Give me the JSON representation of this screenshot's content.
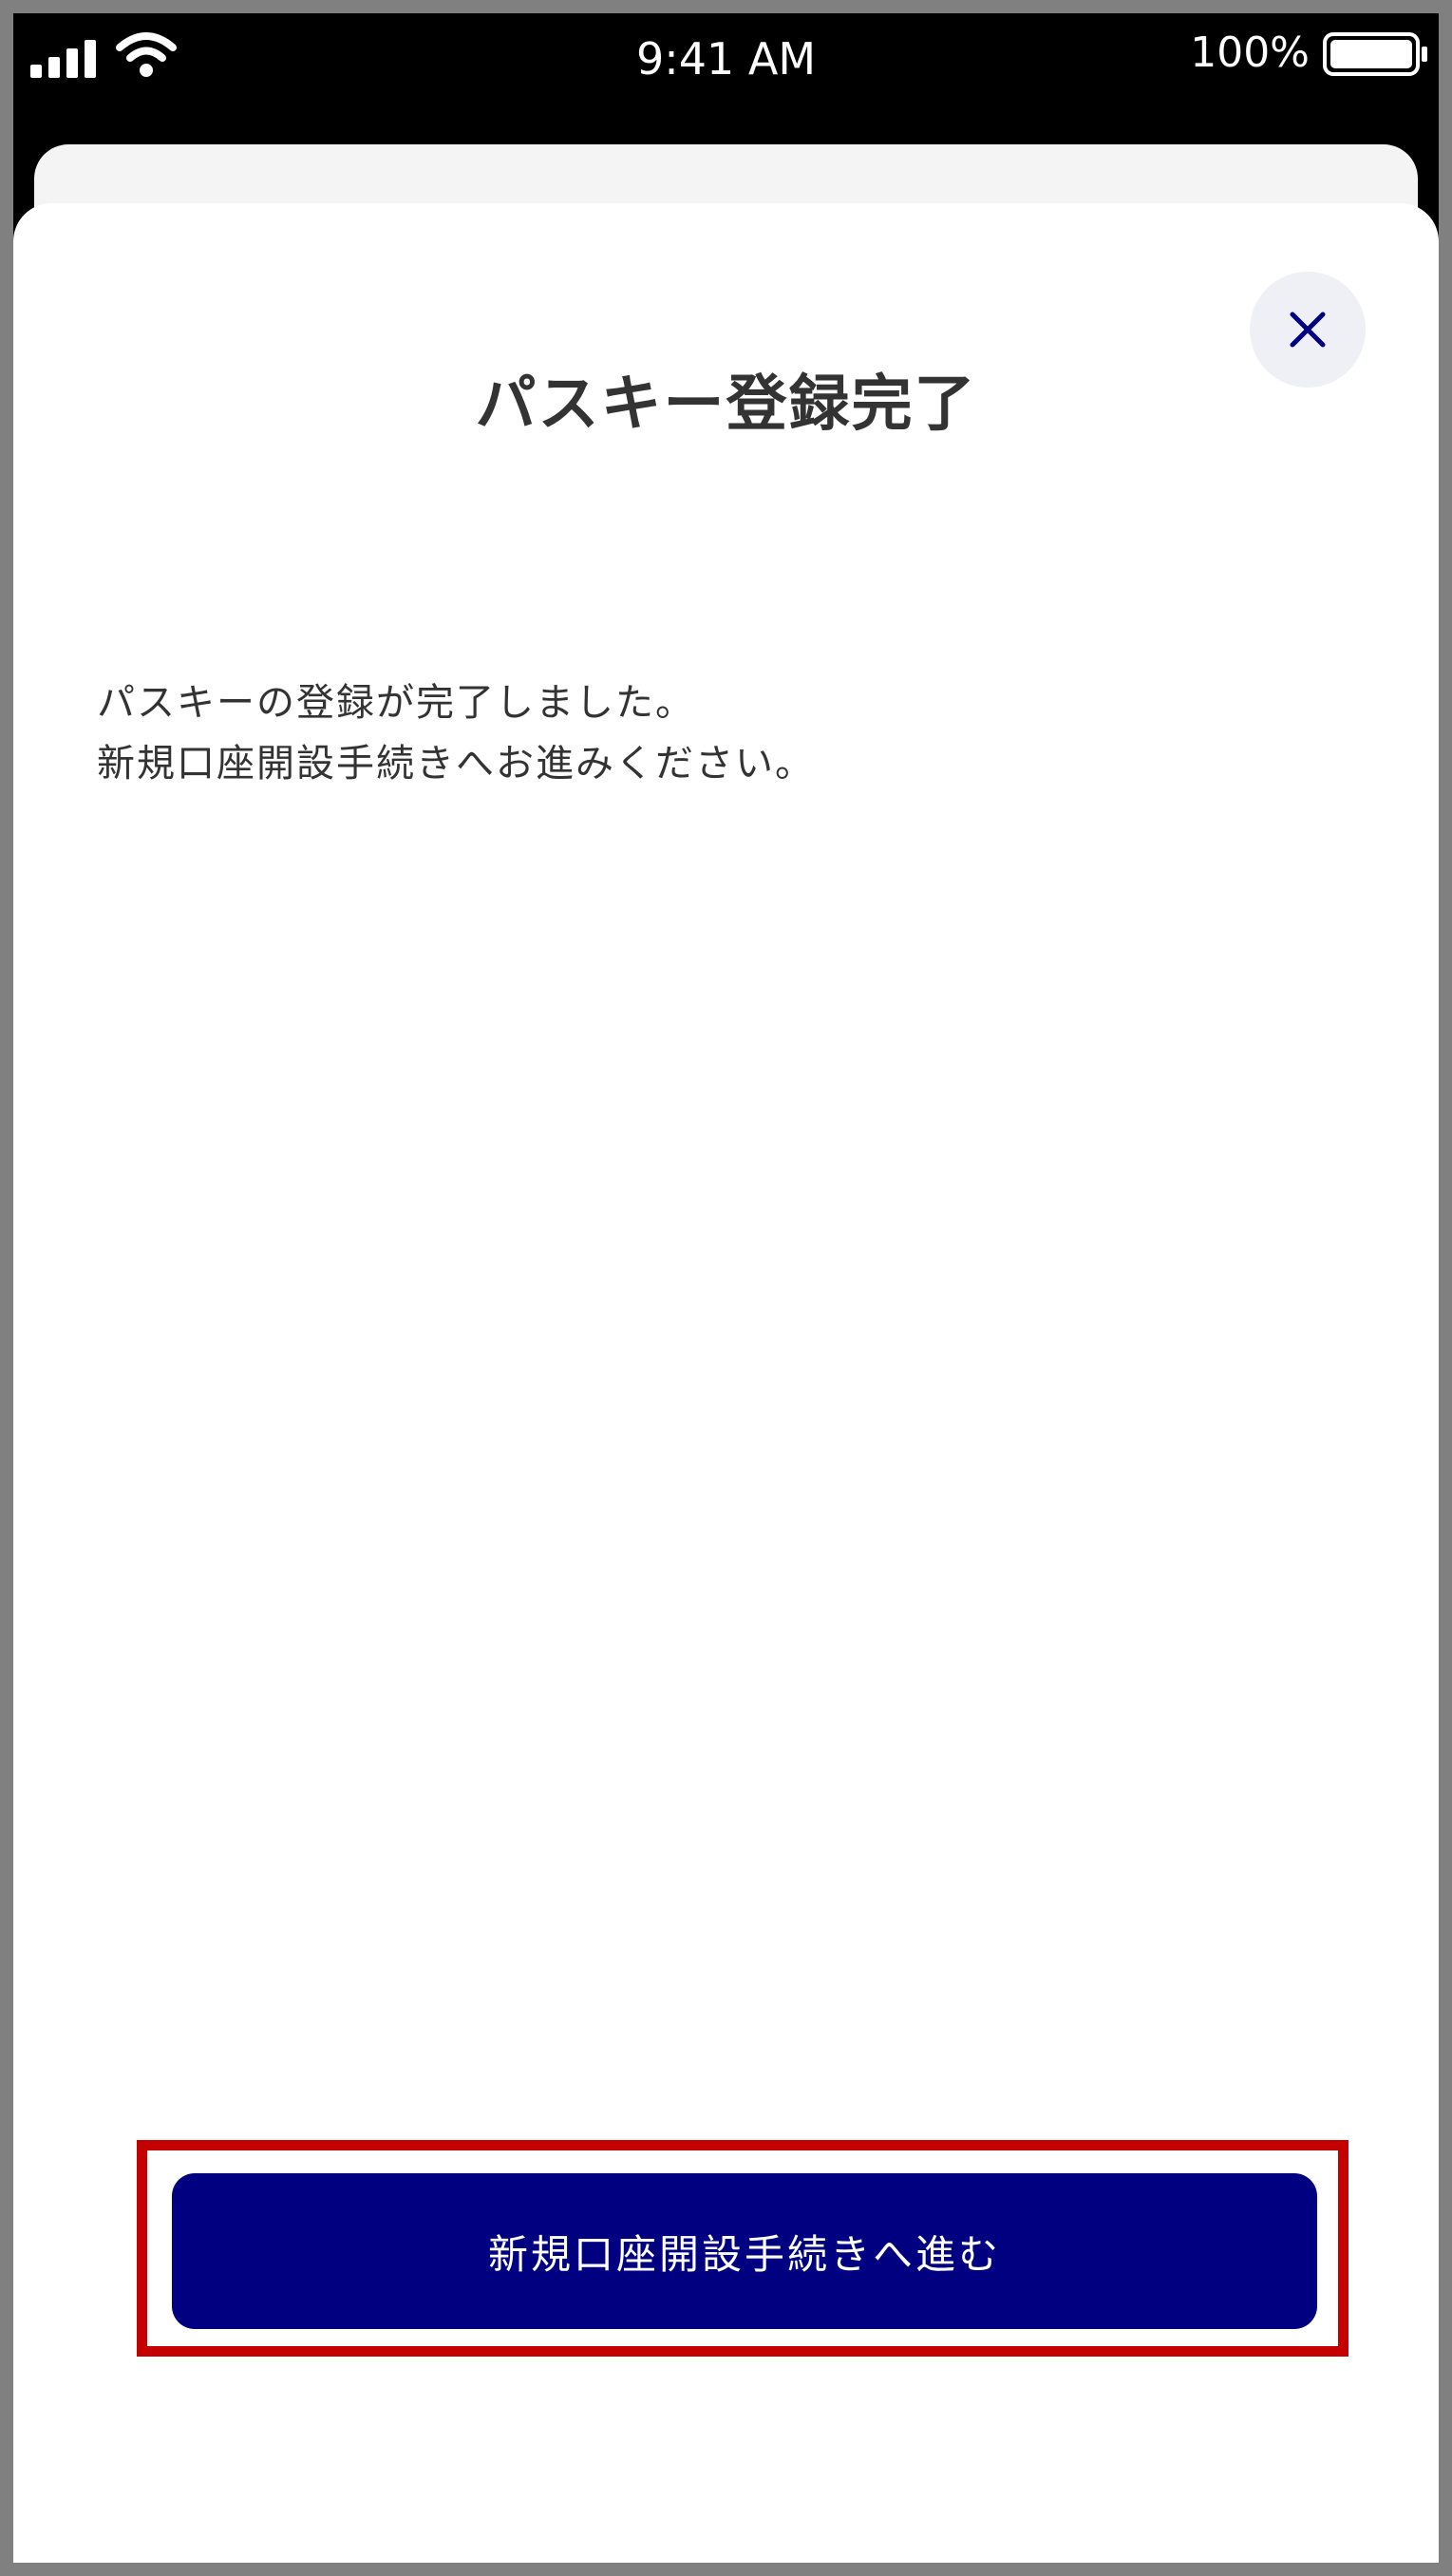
{
  "status_bar": {
    "time": "9:41 AM",
    "battery_percent": "100%",
    "signal_icon": "cellular-signal-icon",
    "wifi_icon": "wifi-icon",
    "battery_icon": "battery-icon"
  },
  "dialog": {
    "title": "パスキー登録完了",
    "close_icon": "close-icon",
    "message_lines": [
      "パスキーの登録が完了しました。",
      "新規口座開設手続きへお進みください。"
    ],
    "primary_button_label": "新規口座開設手続きへ進む"
  },
  "colors": {
    "primary": "#000080",
    "highlight_border": "#c40000",
    "frame_border": "#808080",
    "close_button_bg": "#eef0f5",
    "text": "#333333"
  }
}
